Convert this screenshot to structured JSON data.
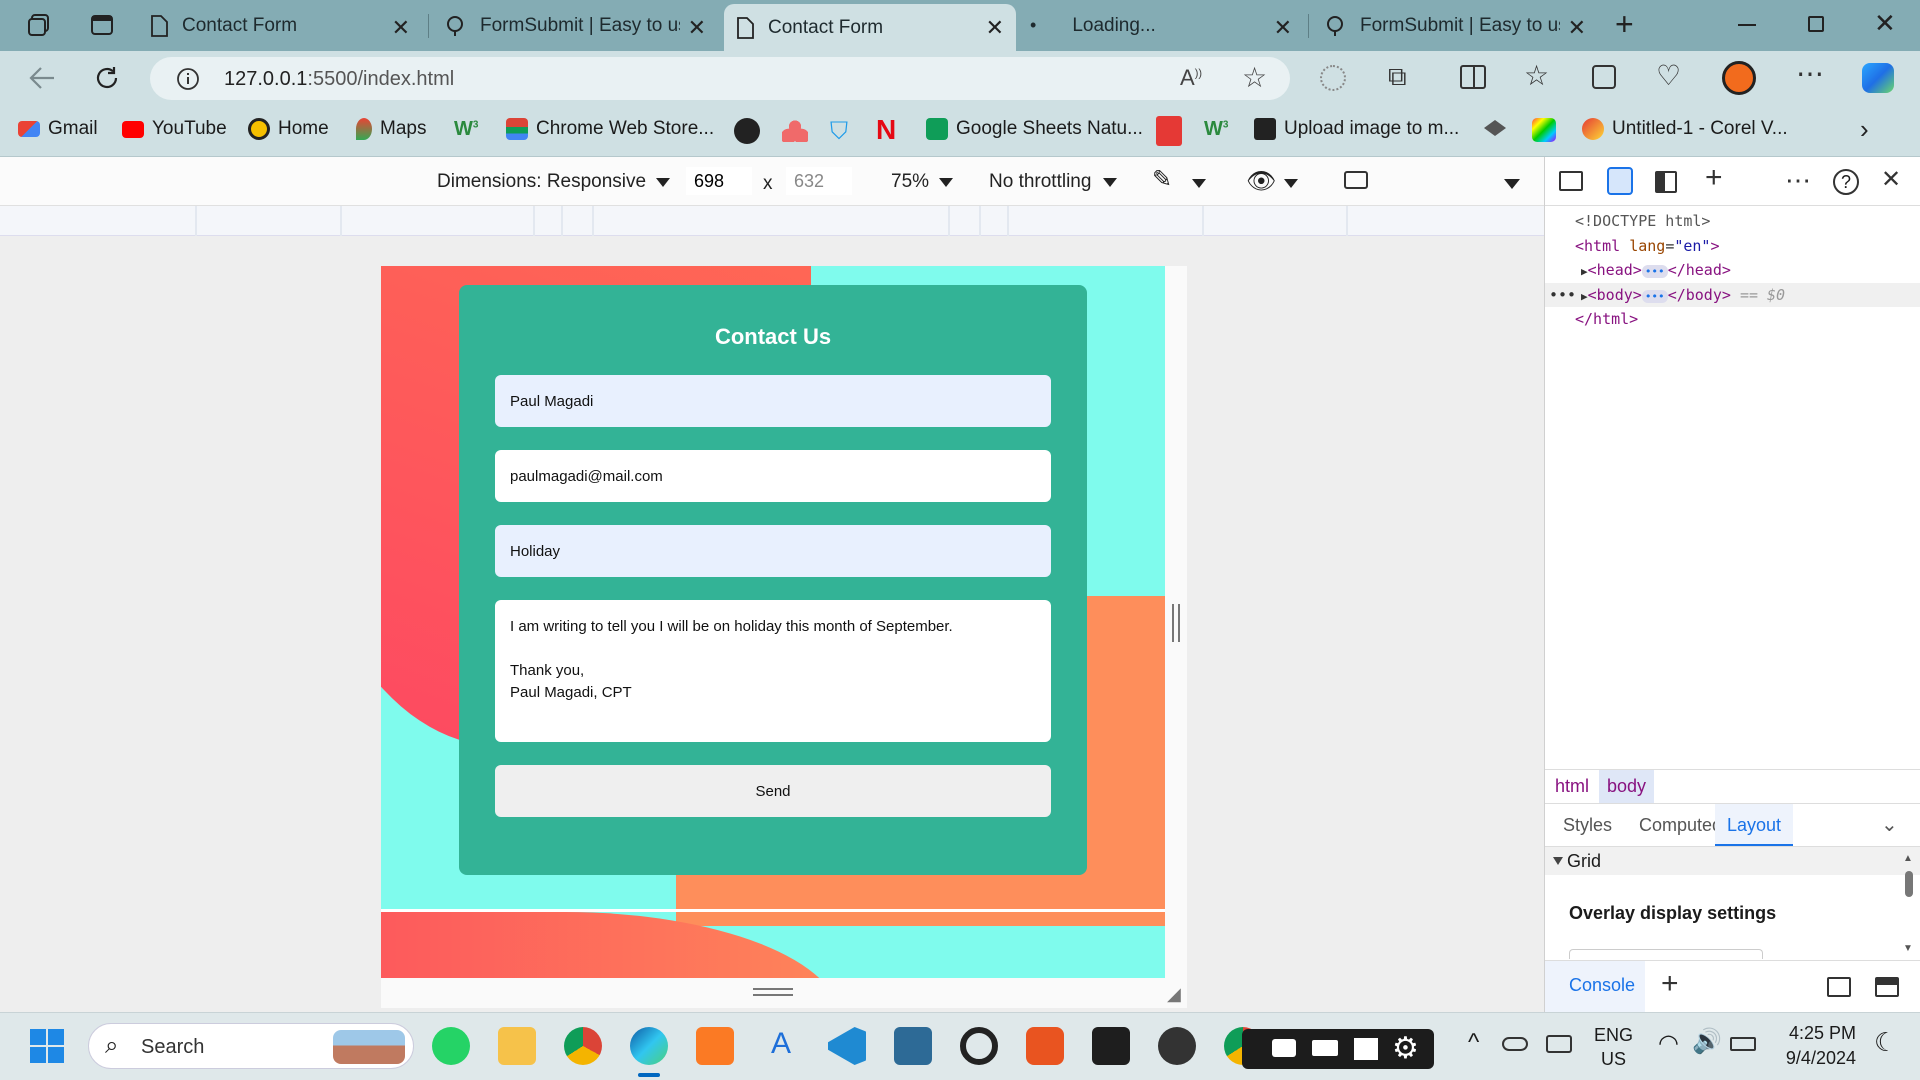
{
  "browser": {
    "tabs": [
      {
        "title": "Contact Form",
        "active": false,
        "icon": "page-icon"
      },
      {
        "title": "FormSubmit | Easy to use",
        "active": false,
        "icon": "formsubmit-icon"
      },
      {
        "title": "Contact Form",
        "active": true,
        "icon": "page-icon"
      },
      {
        "title": "Loading...",
        "active": false,
        "icon": "loading-icon"
      },
      {
        "title": "FormSubmit | Easy to use",
        "active": false,
        "icon": "formsubmit-icon"
      }
    ],
    "address": {
      "host": "127.0.0.1",
      "path": ":5500/index.html"
    },
    "bookmarks": [
      "Gmail",
      "YouTube",
      "Home",
      "Maps",
      "Chrome Web Store...",
      "Google Sheets Natu...",
      "Upload image to m...",
      "Untitled-1 - Corel V..."
    ]
  },
  "device_toolbar": {
    "dimensions_label": "Dimensions: Responsive",
    "width": "698",
    "times": "x",
    "height": "632",
    "zoom": "75%",
    "throttling": "No throttling"
  },
  "page": {
    "heading": "Contact Us",
    "name_value": "Paul Magadi",
    "email_value": "paulmagadi@mail.com",
    "subject_value": "Holiday",
    "message_value": "I am writing to tell you I will be on holiday this month of September.\n\nThank you,\nPaul Magadi, CPT",
    "send_label": "Send",
    "colors": {
      "bg": "#7ffbed",
      "card": "#33b396",
      "coral": "#fd4862",
      "orange": "#fe8e5b"
    }
  },
  "devtools": {
    "dom": {
      "doctype": "<!DOCTYPE html>",
      "html_open_tag": "html",
      "html_attr_name": "lang",
      "html_attr_value": "\"en\"",
      "head": "head",
      "body": "body",
      "selected_marker": "== $0",
      "html_close": "</html>"
    },
    "breadcrumbs": [
      "html",
      "body"
    ],
    "style_tabs": [
      "Styles",
      "Computed",
      "Layout"
    ],
    "grid_section": "Grid",
    "overlay_settings": "Overlay display settings",
    "console_tab": "Console"
  },
  "taskbar": {
    "search_placeholder": "Search",
    "language": "ENG",
    "region": "US",
    "time": "4:25 PM",
    "date": "9/4/2024"
  }
}
